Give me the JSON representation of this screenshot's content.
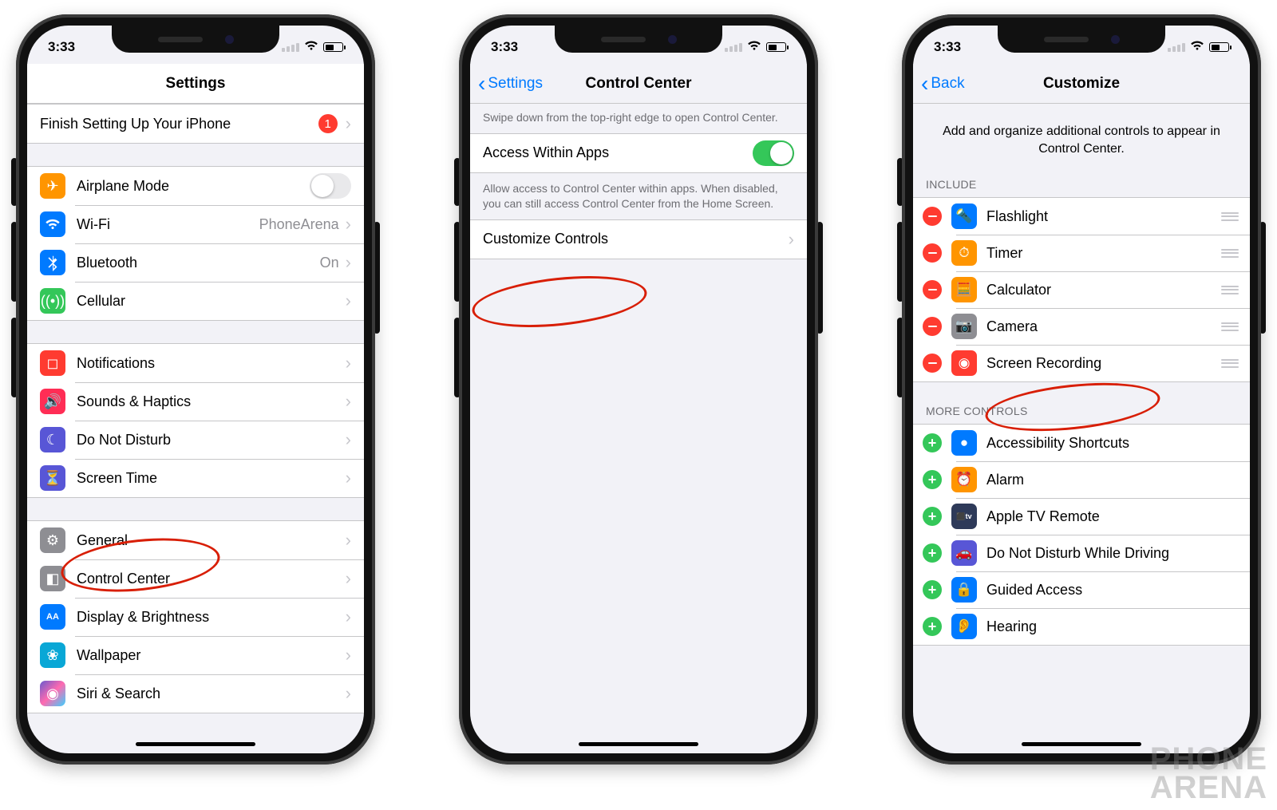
{
  "status": {
    "time": "3:33"
  },
  "watermark": {
    "line1": "PHONE",
    "line2": "ARENA"
  },
  "p1": {
    "title": "Settings",
    "setup": {
      "label": "Finish Setting Up Your iPhone",
      "badge": "1"
    },
    "net": {
      "airplane": "Airplane Mode",
      "wifi": {
        "label": "Wi-Fi",
        "value": "PhoneArena"
      },
      "bluetooth": {
        "label": "Bluetooth",
        "value": "On"
      },
      "cellular": "Cellular"
    },
    "g2": {
      "notifications": "Notifications",
      "sounds": "Sounds & Haptics",
      "dnd": "Do Not Disturb",
      "screentime": "Screen Time"
    },
    "g3": {
      "general": "General",
      "controlcenter": "Control Center",
      "display": "Display & Brightness",
      "wallpaper": "Wallpaper",
      "siri": "Siri & Search"
    }
  },
  "p2": {
    "back": "Settings",
    "title": "Control Center",
    "caption1": "Swipe down from the top-right edge to open Control Center.",
    "access": "Access Within Apps",
    "caption2": "Allow access to Control Center within apps. When disabled, you can still access Control Center from the Home Screen.",
    "customize": "Customize Controls"
  },
  "p3": {
    "back": "Back",
    "title": "Customize",
    "caption": "Add and organize additional controls to appear in Control Center.",
    "include_hd": "INCLUDE",
    "include": [
      {
        "label": "Flashlight",
        "icon": "flashlight",
        "color": "ic-blue",
        "glyph": "🔦"
      },
      {
        "label": "Timer",
        "icon": "timer",
        "color": "ic-orange",
        "glyph": "⏱"
      },
      {
        "label": "Calculator",
        "icon": "calculator",
        "color": "ic-orange",
        "glyph": "🧮"
      },
      {
        "label": "Camera",
        "icon": "camera",
        "color": "ic-gray",
        "glyph": "📷"
      },
      {
        "label": "Screen Recording",
        "icon": "screen-recording",
        "color": "ic-red",
        "glyph": "◉"
      }
    ],
    "more_hd": "MORE CONTROLS",
    "more": [
      {
        "label": "Accessibility Shortcuts",
        "icon": "accessibility",
        "color": "ic-blue",
        "glyph": "●"
      },
      {
        "label": "Alarm",
        "icon": "alarm",
        "color": "ic-orange",
        "glyph": "⏰"
      },
      {
        "label": "Apple TV Remote",
        "icon": "apple-tv-remote",
        "color": "ic-navy",
        "glyph": "tv"
      },
      {
        "label": "Do Not Disturb While Driving",
        "icon": "dnd-driving",
        "color": "ic-purple",
        "glyph": "🚗"
      },
      {
        "label": "Guided Access",
        "icon": "guided-access",
        "color": "ic-blue",
        "glyph": "🔒"
      },
      {
        "label": "Hearing",
        "icon": "hearing",
        "color": "ic-blue",
        "glyph": "👂"
      }
    ]
  }
}
